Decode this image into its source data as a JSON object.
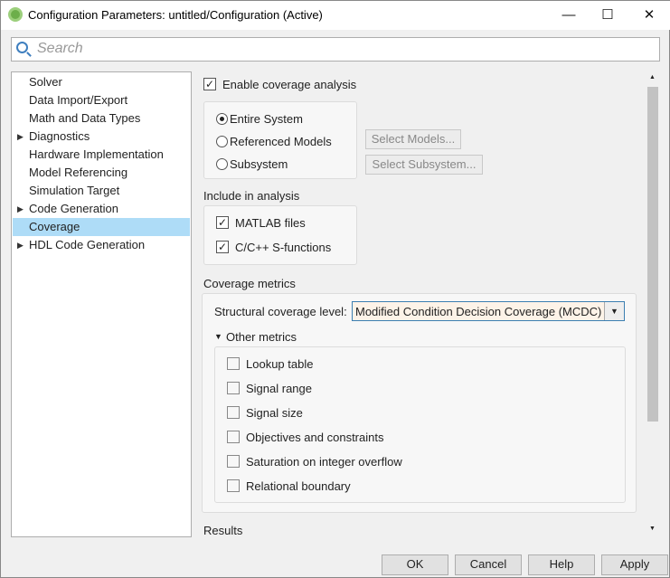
{
  "window": {
    "title": "Configuration Parameters: untitled/Configuration (Active)",
    "minimize": "—",
    "maximize": "☐",
    "close": "✕"
  },
  "search": {
    "placeholder": "Search"
  },
  "tree": [
    {
      "label": "Solver",
      "expandable": false
    },
    {
      "label": "Data Import/Export",
      "expandable": false
    },
    {
      "label": "Math and Data Types",
      "expandable": false
    },
    {
      "label": "Diagnostics",
      "expandable": true
    },
    {
      "label": "Hardware Implementation",
      "expandable": false
    },
    {
      "label": "Model Referencing",
      "expandable": false
    },
    {
      "label": "Simulation Target",
      "expandable": false
    },
    {
      "label": "Code Generation",
      "expandable": true
    },
    {
      "label": "Coverage",
      "expandable": false,
      "selected": true
    },
    {
      "label": "HDL Code Generation",
      "expandable": true
    }
  ],
  "coverage": {
    "enable_label": "Enable coverage analysis",
    "enable_checked": true,
    "scope": {
      "options": [
        "Entire System",
        "Referenced Models",
        "Subsystem"
      ],
      "selected": "Entire System"
    },
    "select_models": "Select Models...",
    "select_subsystem": "Select Subsystem...",
    "include_heading": "Include in analysis",
    "include": [
      {
        "label": "MATLAB files",
        "checked": true
      },
      {
        "label": "C/C++ S-functions",
        "checked": true
      }
    ],
    "metrics_heading": "Coverage metrics",
    "structural_label": "Structural coverage level:",
    "structural_value": "Modified Condition Decision Coverage (MCDC)",
    "other_metrics": "Other metrics",
    "other": [
      {
        "label": "Lookup table",
        "checked": false
      },
      {
        "label": "Signal range",
        "checked": false
      },
      {
        "label": "Signal size",
        "checked": false
      },
      {
        "label": "Objectives and constraints",
        "checked": false
      },
      {
        "label": "Saturation on integer overflow",
        "checked": false
      },
      {
        "label": "Relational boundary",
        "checked": false
      }
    ],
    "results_heading": "Results"
  },
  "buttons": {
    "ok": "OK",
    "cancel": "Cancel",
    "help": "Help",
    "apply": "Apply"
  }
}
